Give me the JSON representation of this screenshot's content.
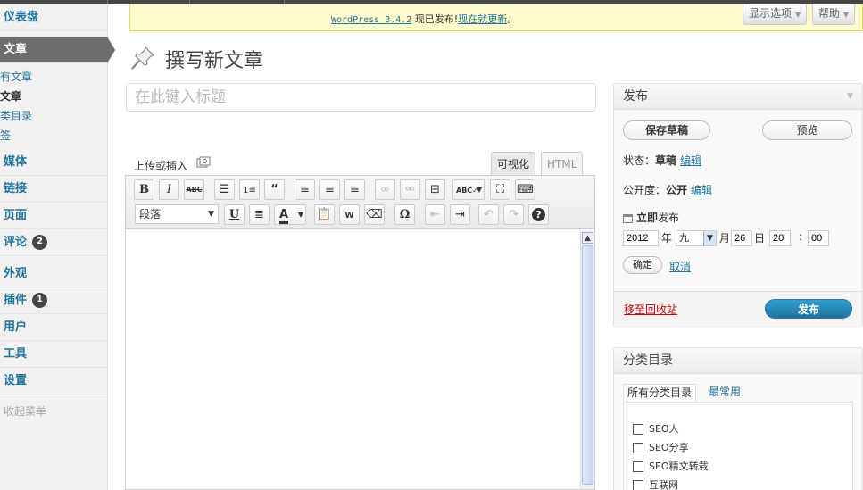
{
  "sidebar": {
    "items": [
      {
        "label": "仪表盘"
      },
      {
        "label": "文章"
      },
      {
        "label": "媒体"
      },
      {
        "label": "链接"
      },
      {
        "label": "页面"
      },
      {
        "label": "评论",
        "badge": "2"
      },
      {
        "label": "外观"
      },
      {
        "label": "插件",
        "badge": "1"
      },
      {
        "label": "用户"
      },
      {
        "label": "工具"
      },
      {
        "label": "设置"
      }
    ],
    "subitems": [
      "有文章",
      "文章",
      "类目录",
      "签"
    ],
    "collapse_label": "收起菜单"
  },
  "notice": {
    "version_link": "WordPress 3.4.2",
    "text": "现已发布!",
    "update_link": "现在就更新",
    "end": "。"
  },
  "header": {
    "screen_options": "显示选项",
    "help": "帮助",
    "page_title": "撰写新文章"
  },
  "editor": {
    "title_placeholder": "在此键入标题",
    "upload_label": "上传或插入",
    "tab_visual": "可视化",
    "tab_html": "HTML",
    "format_select": "段落"
  },
  "publish": {
    "title": "发布",
    "save_draft": "保存草稿",
    "preview": "预览",
    "status_label": "状态：",
    "status_value": "草稿",
    "edit": "编辑",
    "visibility_label": "公开度：",
    "visibility_value": "公开",
    "publish_label": "立即",
    "publish_label_suffix": "发布",
    "year": "2012",
    "year_unit": "年",
    "month": "九",
    "month_unit": "月",
    "day": "26",
    "day_unit": "日",
    "hour": "20",
    "colon": ":",
    "minute": "00",
    "ok": "确定",
    "cancel": "取消",
    "trash": "移至回收站",
    "publish_button": "发布"
  },
  "categories": {
    "title": "分类目录",
    "tab_all": "所有分类目录",
    "tab_popular": "最常用",
    "items": [
      "SEO人",
      "SEO分享",
      "SEO精文转载",
      "互联网"
    ]
  }
}
